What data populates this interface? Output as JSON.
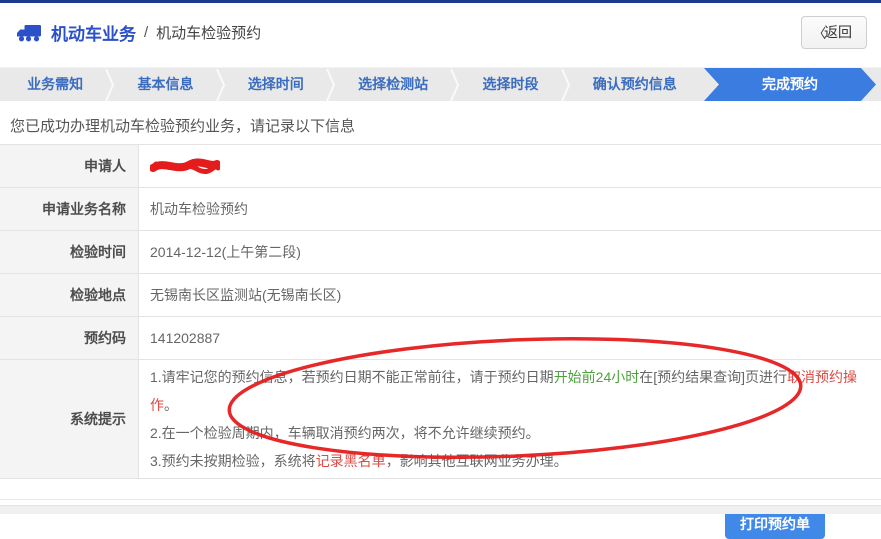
{
  "page": {
    "title_bar": {
      "icon": "truck-icon",
      "title": "机动车业务",
      "separator": "/",
      "breadcrumb": "机动车检验预约",
      "back_button": {
        "chevron": "〈",
        "label": "返回"
      }
    },
    "colors": {
      "top_border": "#1d3a8f",
      "brand_blue": "#2b50c8",
      "step_text": "#3a6cbf",
      "active_step_bg": "#3b7ce0",
      "button_bg": "#4189e8",
      "green_text": "#4da23c",
      "red_text": "#dd4a43",
      "annotation_red": "#e51c1c"
    },
    "steps": [
      {
        "label": "业务需知",
        "active": false
      },
      {
        "label": "基本信息",
        "active": false
      },
      {
        "label": "选择时间",
        "active": false
      },
      {
        "label": "选择检测站",
        "active": false
      },
      {
        "label": "选择时段",
        "active": false
      },
      {
        "label": "确认预约信息",
        "active": false
      },
      {
        "label": "完成预约",
        "active": true
      }
    ],
    "message": "您已成功办理机动车检验预约业务，请记录以下信息",
    "table": {
      "rows": [
        {
          "label": "申请人",
          "value": "",
          "redacted": true
        },
        {
          "label": "申请业务名称",
          "value": "机动车检验预约"
        },
        {
          "label": "检验时间",
          "value": "2014-12-12(上午第二段)"
        },
        {
          "label": "检验地点",
          "value": "无锡南长区监测站(无锡南长区)"
        },
        {
          "label": "预约码",
          "value": "141202887"
        },
        {
          "label": "系统提示",
          "value": ""
        }
      ]
    },
    "tips": [
      [
        {
          "text": "1.请牢记您的预约信息，若预约日期不能正常前往，请于预约日期",
          "color": "normal"
        },
        {
          "text": "开始前24小时",
          "color": "green"
        },
        {
          "text": "在[预约结果查询]页进行",
          "color": "normal"
        },
        {
          "text": "取消预约操作",
          "color": "red"
        },
        {
          "text": "。",
          "color": "normal"
        }
      ],
      [
        {
          "text": "2.在一个检验周期内，车辆取消预约两次，将不允许继续预约。",
          "color": "normal"
        }
      ],
      [
        {
          "text": "3.预约未按期检验，系统将",
          "color": "normal"
        },
        {
          "text": "记录黑名单",
          "color": "red"
        },
        {
          "text": "，影响其他互联网业务办理。",
          "color": "normal"
        }
      ]
    ],
    "annotation": {
      "shape": "hand-drawn-ellipse",
      "color": "#e51c1c"
    },
    "print_button": "打印预约单"
  }
}
